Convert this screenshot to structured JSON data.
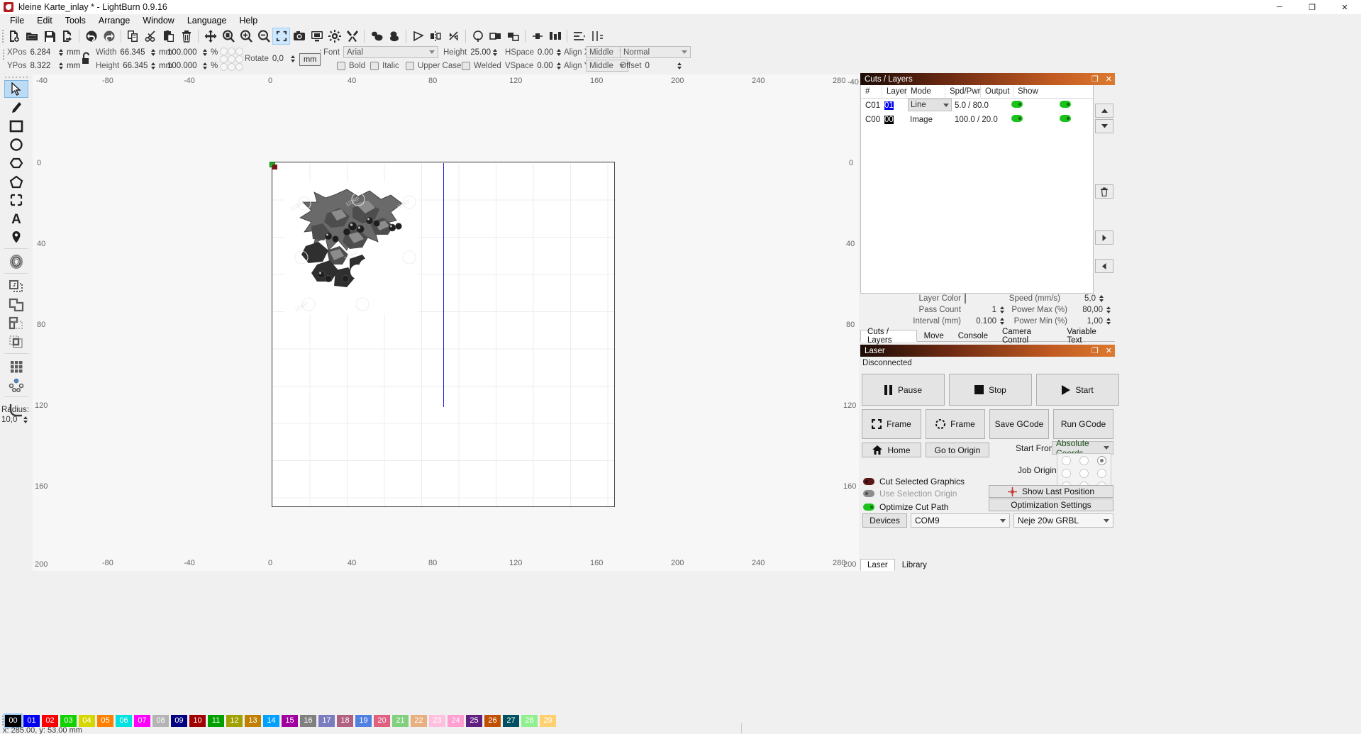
{
  "window": {
    "title": "kleine Karte_inlay * - LightBurn 0.9.16",
    "app_icon": "lightburn-logo-icon",
    "minimize": "─",
    "maximize": "❐",
    "close": "✕"
  },
  "menubar": {
    "items": [
      "File",
      "Edit",
      "Tools",
      "Arrange",
      "Window",
      "Language",
      "Help"
    ]
  },
  "toolbar": {
    "buttons": [
      {
        "name": "new-file-icon",
        "tip": "New"
      },
      {
        "name": "open-file-icon",
        "tip": "Open"
      },
      {
        "name": "save-file-icon",
        "tip": "Save"
      },
      {
        "name": "export-file-icon",
        "tip": "Export"
      },
      {
        "name": "undo-icon",
        "tip": "Undo"
      },
      {
        "name": "redo-icon",
        "tip": "Redo"
      },
      {
        "name": "copy-icon",
        "tip": "Copy"
      },
      {
        "name": "cut-icon",
        "tip": "Cut"
      },
      {
        "name": "paste-icon",
        "tip": "Paste"
      },
      {
        "name": "delete-icon",
        "tip": "Delete"
      },
      {
        "name": "move-icon",
        "tip": "Move"
      },
      {
        "name": "zoom-fit-page-icon",
        "tip": "Zoom to Page"
      },
      {
        "name": "zoom-in-icon",
        "tip": "Zoom In"
      },
      {
        "name": "zoom-out-icon",
        "tip": "Zoom Out"
      },
      {
        "name": "frame-selection-icon",
        "tip": "Zoom to Selection"
      },
      {
        "name": "camera-icon",
        "tip": "Camera Capture"
      },
      {
        "name": "preview-icon",
        "tip": "Preview"
      },
      {
        "name": "machine-settings-icon",
        "tip": "Machine Settings"
      },
      {
        "name": "device-settings-icon",
        "tip": "Device Settings"
      },
      {
        "name": "group-icon",
        "tip": "Group"
      },
      {
        "name": "ungroup-icon",
        "tip": "Ungroup"
      },
      {
        "name": "node-edit-icon",
        "tip": "Edit Nodes"
      },
      {
        "name": "mirror-horizontal-icon",
        "tip": "Mirror Horizontally"
      },
      {
        "name": "mirror-vertical-icon",
        "tip": "Mirror Vertically"
      },
      {
        "name": "weld-icon",
        "tip": "Weld"
      },
      {
        "name": "boolean-union-icon",
        "tip": "Boolean Union"
      },
      {
        "name": "offset-shapes-icon",
        "tip": "Offset Shapes"
      },
      {
        "name": "align-left-icon",
        "tip": "Align Left"
      },
      {
        "name": "align-center-icon",
        "tip": "Align Center"
      },
      {
        "name": "distribute-icon",
        "tip": "Distribute"
      },
      {
        "name": "array-icon",
        "tip": "Array"
      },
      {
        "name": "measure-icon",
        "tip": "Measure"
      }
    ]
  },
  "properties": {
    "xpos_label": "XPos",
    "xpos_value": "6.284",
    "xpos_unit": "mm",
    "ypos_label": "YPos",
    "ypos_value": "8.322",
    "ypos_unit": "mm",
    "lock_icon": "unlocked-padlock-icon",
    "width_label": "Width",
    "width_value": "66.345",
    "width_unit": "mm",
    "width_pct": "100.000",
    "pct_sign": "%",
    "height_label": "Height",
    "height_value": "66.345",
    "height_unit": "mm",
    "height_pct": "100.000",
    "rotate_label": "Rotate",
    "rotate_value": "0,0",
    "unit_button": "mm",
    "font_label": "Font",
    "font_value": "Arial",
    "text_height_label": "Height",
    "text_height_value": "25.00",
    "hspace_label": "HSpace",
    "hspace_value": "0.00",
    "vspace_label": "VSpace",
    "vspace_value": "0.00",
    "align_x_label": "Align X",
    "align_x_value": "Middle",
    "align_y_label": "Align Y",
    "align_y_value": "Middle",
    "style_value": "Normal",
    "bold_label": "Bold",
    "italic_label": "Italic",
    "upper_case_label": "Upper Case",
    "welded_label": "Welded",
    "offset_label": "Offset",
    "offset_value": "0"
  },
  "tools": {
    "items": [
      {
        "name": "select-tool",
        "icon": "cursor-arrow-icon",
        "active": true
      },
      {
        "name": "draw-lines-tool",
        "icon": "pencil-icon",
        "active": false
      },
      {
        "name": "rectangle-tool",
        "icon": "rectangle-icon",
        "active": false
      },
      {
        "name": "ellipse-tool",
        "icon": "circle-icon",
        "active": false
      },
      {
        "name": "polygon-tool",
        "icon": "hexagon-icon",
        "active": false
      },
      {
        "name": "closed-shape-tool",
        "icon": "pentagon-icon",
        "active": false
      },
      {
        "name": "capture-tool",
        "icon": "dashed-rectangle-icon",
        "active": false
      },
      {
        "name": "text-tool",
        "icon": "letter-a-icon",
        "active": false
      },
      {
        "name": "position-tool",
        "icon": "map-pin-icon",
        "active": false
      },
      {
        "name": "offset-tool",
        "icon": "concentric-ring-icon",
        "active": false
      },
      {
        "name": "boolean-assist-tool",
        "icon": "overlap-shapes-icon",
        "active": false
      },
      {
        "name": "boolean-union-tool",
        "icon": "union-shapes-icon",
        "active": false
      },
      {
        "name": "boolean-subtract-tool",
        "icon": "subtract-shapes-icon",
        "active": false
      },
      {
        "name": "boolean-intersect-tool",
        "icon": "intersect-shapes-icon",
        "active": false
      },
      {
        "name": "grid-array-tool",
        "icon": "grid-nine-squares-icon",
        "active": false
      },
      {
        "name": "circular-array-tool",
        "icon": "circular-array-icon",
        "active": false
      },
      {
        "name": "radius-tool",
        "icon": "fillet-radius-icon",
        "active": false
      }
    ],
    "radius_label": "Radius:",
    "radius_value": "10,0"
  },
  "canvas": {
    "ruler_top_ticks": [
      "-40",
      "-80",
      "-40",
      "0",
      "40",
      "80",
      "120",
      "160",
      "200",
      "240",
      "280"
    ],
    "ruler_bottom_ticks": [
      "-80",
      "-40",
      "0",
      "40",
      "80",
      "120",
      "160",
      "200",
      "240",
      "280"
    ],
    "ruler_left_ticks": [
      "0",
      "40",
      "80",
      "120",
      "160",
      "200"
    ],
    "ruler_right_ticks": [
      "-40",
      "0",
      "40",
      "80",
      "120",
      "160",
      "200"
    ],
    "artwork_name": "holly-leaves-berries-image"
  },
  "cuts_panel": {
    "title": "Cuts / Layers",
    "float_icon": "float-panel-icon",
    "close_icon": "close-panel-icon",
    "columns": [
      "#",
      "Layer",
      "Mode",
      "Spd/Pwr",
      "Output",
      "Show"
    ],
    "rows": [
      {
        "num": "C01",
        "layer": "01",
        "layer_color": "#0000ee",
        "mode": "Line",
        "spd_pwr": "5.0 / 80.0",
        "output": true,
        "show": true,
        "selected": true
      },
      {
        "num": "C00",
        "layer": "00",
        "layer_color": "#000000",
        "mode": "Image",
        "spd_pwr": "100.0 / 20.0",
        "output": true,
        "show": true,
        "selected": false
      }
    ],
    "side_buttons": [
      "move-up-icon",
      "move-down-icon",
      "delete-icon",
      "move-right-icon",
      "move-left-icon"
    ],
    "params": {
      "layer_color_label": "Layer Color",
      "layer_color_value": "#000000",
      "speed_label": "Speed (mm/s)",
      "speed_value": "5,0",
      "pass_count_label": "Pass Count",
      "pass_count_value": "1",
      "power_max_label": "Power Max (%)",
      "power_max_value": "80,00",
      "interval_label": "Interval (mm)",
      "interval_value": "0.100",
      "power_min_label": "Power Min (%)",
      "power_min_value": "1,00"
    },
    "tabs": [
      {
        "label": "Cuts / Layers",
        "selected": true
      },
      {
        "label": "Move",
        "selected": false
      },
      {
        "label": "Console",
        "selected": false
      },
      {
        "label": "Camera Control",
        "selected": false
      },
      {
        "label": "Variable Text",
        "selected": false
      }
    ]
  },
  "laser_panel": {
    "title": "Laser",
    "float_icon": "float-panel-icon",
    "close_icon": "close-panel-icon",
    "status": "Disconnected",
    "pause_label": "Pause",
    "stop_label": "Stop",
    "start_label": "Start",
    "frame_square_label": "Frame",
    "frame_round_label": "Frame",
    "save_gcode_label": "Save GCode",
    "run_gcode_label": "Run GCode",
    "home_label": "Home",
    "go_to_origin_label": "Go to Origin",
    "start_from_label": "Start From:",
    "start_from_value": "Absolute Coords",
    "job_origin_label": "Job Origin",
    "job_origin_selected": 2,
    "cut_selected_label": "Cut Selected Graphics",
    "cut_selected_state": "dark",
    "use_selection_origin_label": "Use Selection Origin",
    "use_selection_origin_state": "off",
    "optimize_cut_path_label": "Optimize Cut Path",
    "optimize_cut_path_state": "on",
    "show_last_position_label": "Show Last Position",
    "optimization_settings_label": "Optimization Settings",
    "devices_label": "Devices",
    "port_value": "COM9",
    "device_value": "Neje 20w GRBL",
    "tabs": [
      {
        "label": "Laser",
        "selected": true
      },
      {
        "label": "Library",
        "selected": false
      }
    ]
  },
  "palette": {
    "colors": [
      {
        "num": "00",
        "hex": "#000000",
        "selected": true
      },
      {
        "num": "01",
        "hex": "#0000ee"
      },
      {
        "num": "02",
        "hex": "#fb0000"
      },
      {
        "num": "03",
        "hex": "#13d100"
      },
      {
        "num": "04",
        "hex": "#d6d600"
      },
      {
        "num": "05",
        "hex": "#ff8000"
      },
      {
        "num": "06",
        "hex": "#00e1e1"
      },
      {
        "num": "07",
        "hex": "#ff00ff"
      },
      {
        "num": "08",
        "hex": "#b4b4b4"
      },
      {
        "num": "09",
        "hex": "#000080"
      },
      {
        "num": "10",
        "hex": "#a00000"
      },
      {
        "num": "11",
        "hex": "#00a000"
      },
      {
        "num": "12",
        "hex": "#a0a000"
      },
      {
        "num": "13",
        "hex": "#c08000"
      },
      {
        "num": "14",
        "hex": "#00a0ff"
      },
      {
        "num": "15",
        "hex": "#a000a0"
      },
      {
        "num": "16",
        "hex": "#808080"
      },
      {
        "num": "17",
        "hex": "#7b7bc0"
      },
      {
        "num": "18",
        "hex": "#b06080"
      },
      {
        "num": "19",
        "hex": "#5080e0"
      },
      {
        "num": "20",
        "hex": "#e06080"
      },
      {
        "num": "21",
        "hex": "#80d080"
      },
      {
        "num": "22",
        "hex": "#e8b080"
      },
      {
        "num": "23",
        "hex": "#ffc0e0"
      },
      {
        "num": "24",
        "hex": "#ff9ed0"
      },
      {
        "num": "25",
        "hex": "#602080"
      },
      {
        "num": "26",
        "hex": "#c05000"
      },
      {
        "num": "27",
        "hex": "#005060"
      },
      {
        "num": "28",
        "hex": "#90f090"
      },
      {
        "num": "29",
        "hex": "#ffd070"
      }
    ]
  },
  "statusbar": {
    "coords": "x: 285.00, y: 53.00 mm"
  }
}
